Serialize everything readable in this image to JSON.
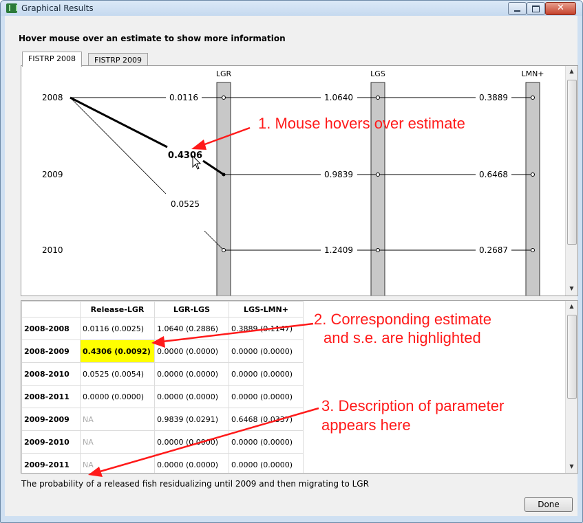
{
  "window": {
    "title": "Graphical Results",
    "icon": "app-icon",
    "controls": {
      "minimize": "minimize-icon",
      "maximize": "maximize-icon",
      "close": "✕"
    }
  },
  "heading": "Hover mouse over an estimate to show more information",
  "tabs": [
    {
      "label": "FISTRP 2008",
      "active": true
    },
    {
      "label": "FISTRP 2009",
      "active": false
    }
  ],
  "graph": {
    "columns": [
      "LGR",
      "LGS",
      "LMN+"
    ],
    "rows": [
      "2008",
      "2009",
      "2010"
    ],
    "release_labels": [
      "0.0116",
      "0.4306",
      "0.0525"
    ],
    "estimates": [
      [
        "1.0640",
        "0.3889"
      ],
      [
        "0.9839",
        "0.6468"
      ],
      [
        "1.2409",
        "0.2687"
      ]
    ],
    "highlighted": "0.4306"
  },
  "table": {
    "headers": [
      "",
      "Release-LGR",
      "LGR-LGS",
      "LGS-LMN+"
    ],
    "rows": [
      {
        "label": "2008-2008",
        "cells": [
          "0.0116 (0.0025)",
          "1.0640 (0.2886)",
          "0.3889 (0.1147)"
        ]
      },
      {
        "label": "2008-2009",
        "cells": [
          "0.4306 (0.0092)",
          "0.0000 (0.0000)",
          "0.0000 (0.0000)"
        ]
      },
      {
        "label": "2008-2010",
        "cells": [
          "0.0525 (0.0054)",
          "0.0000 (0.0000)",
          "0.0000 (0.0000)"
        ]
      },
      {
        "label": "2008-2011",
        "cells": [
          "0.0000 (0.0000)",
          "0.0000 (0.0000)",
          "0.0000 (0.0000)"
        ]
      },
      {
        "label": "2009-2009",
        "cells": [
          "NA",
          "0.9839 (0.0291)",
          "0.6468 (0.0337)"
        ]
      },
      {
        "label": "2009-2010",
        "cells": [
          "NA",
          "0.0000 (0.0000)",
          "0.0000 (0.0000)"
        ]
      },
      {
        "label": "2009-2011",
        "cells": [
          "NA",
          "0.0000 (0.0000)",
          "0.0000 (0.0000)"
        ]
      }
    ]
  },
  "description": "The probability of a released fish residualizing until 2009 and then migrating to LGR",
  "done_label": "Done",
  "annotations": {
    "a1": "1. Mouse hovers over estimate",
    "a2_line1": "2. Corresponding estimate",
    "a2_line2": "and s.e. are highlighted",
    "a3_line1": "3. Description of parameter",
    "a3_line2": "appears here",
    "color": "#ff1a1a"
  },
  "colors": {
    "highlight": "#ffff00",
    "titlebar": "#c5d9ef"
  }
}
